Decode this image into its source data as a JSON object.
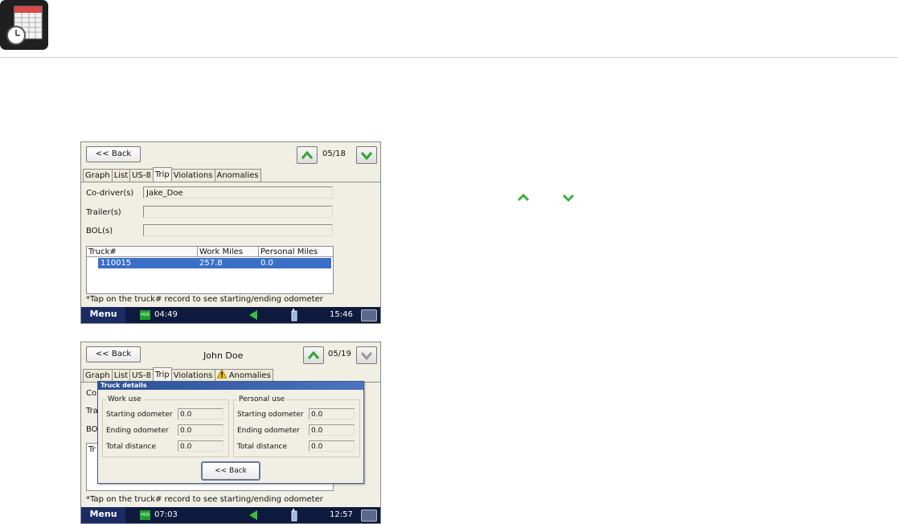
{
  "header": {
    "app_icon": "calendar-clock-icon"
  },
  "side_icons": [
    "arrow-up-icon",
    "arrow-down-icon"
  ],
  "screen1": {
    "back_label": "<< Back",
    "counter": "05/18",
    "tabs": [
      "Graph",
      "List",
      "US-8",
      "Trip",
      "Violations",
      "Anomalies"
    ],
    "active_tab": "Trip",
    "codriver_label": "Co-driver(s)",
    "codriver_value": "Jake_Doe",
    "trailer_label": "Trailer(s)",
    "trailer_value": "",
    "bol_label": "BOL(s)",
    "bol_value": "",
    "table_headers": [
      "Truck#",
      "Work Miles",
      "Personal Miles"
    ],
    "table_row": {
      "truck": "110015",
      "work": "257.8",
      "personal": "0.0"
    },
    "note": "*Tap on the truck# record to see starting/ending odometer",
    "taskbar": {
      "menu": "Menu",
      "hos": "HOS",
      "time_left": "04:49",
      "time_right": "15:46"
    }
  },
  "screen2": {
    "back_label": "<< Back",
    "driver_name": "John Doe",
    "counter": "05/19",
    "tabs": [
      "Graph",
      "List",
      "US-8",
      "Trip",
      "Violations",
      "Anomalies"
    ],
    "active_tab": "Trip",
    "partial_labels": {
      "codriver": "Co",
      "trailer": "Tra",
      "bol": "BO",
      "truck": "Tr"
    },
    "note": "*Tap on the truck# record to see starting/ending odometer",
    "dialog": {
      "title": "Truck details",
      "work_group": "Work use",
      "personal_group": "Personal use",
      "starting_label": "Starting odometer",
      "ending_label": "Ending odometer",
      "total_label": "Total distance",
      "work_starting": "0.0",
      "work_ending": "0.0",
      "work_total": "0.0",
      "personal_starting": "0.0",
      "personal_ending": "0.0",
      "personal_total": "0.0",
      "back_label": "<< Back"
    },
    "taskbar": {
      "menu": "Menu",
      "hos": "HOS",
      "time_left": "07:03",
      "time_right": "12:57"
    }
  }
}
